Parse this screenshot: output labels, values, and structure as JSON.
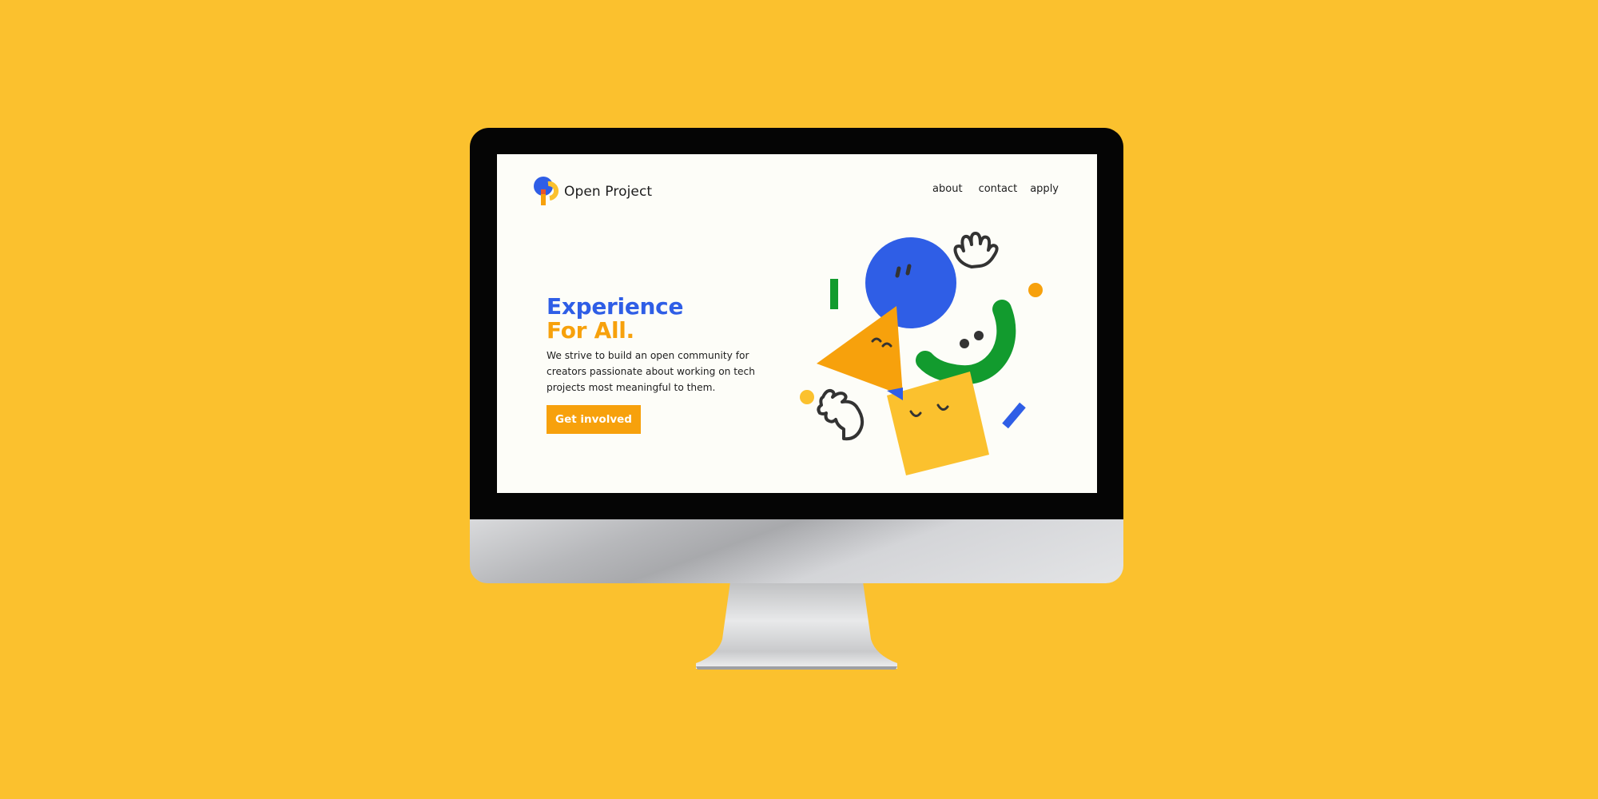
{
  "site": {
    "brand_name": "Open Project",
    "nav": {
      "about": "about",
      "contact": "contact",
      "apply": "apply"
    },
    "hero": {
      "headline_line1": "Experience",
      "headline_line2": "For All.",
      "subtext": "We strive to build an open community for creators passionate about working on tech projects most meaningful to them.",
      "cta_label": "Get involved"
    }
  },
  "colors": {
    "page_background": "#FBC12E",
    "screen_background": "#FDFDF8",
    "brand_blue": "#2F5EE6",
    "brand_orange": "#F7A10C",
    "brand_yellow": "#FBC12E",
    "brand_green": "#129B2E",
    "ink": "#333333"
  },
  "icons": {
    "logo": "open-project-logo-icon",
    "illustration": "abstract-shape-characters-illustration"
  }
}
